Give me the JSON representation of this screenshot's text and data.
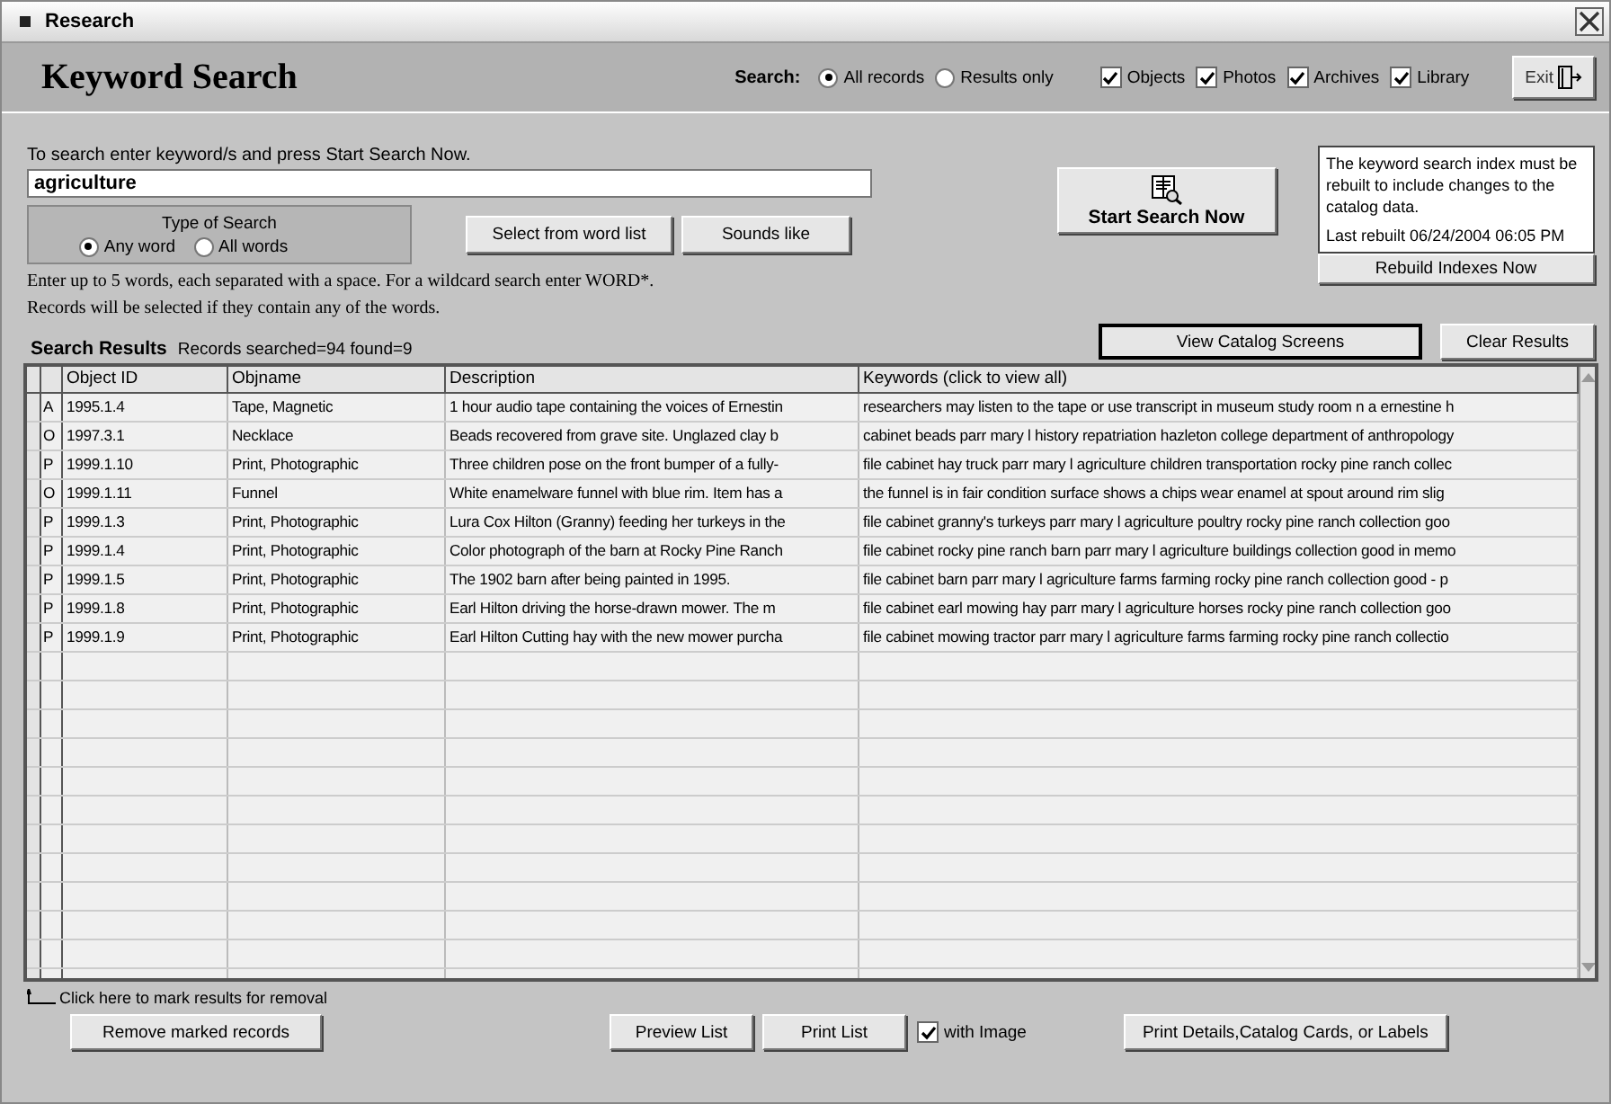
{
  "window": {
    "title": "Research"
  },
  "header": {
    "title": "Keyword Search",
    "search_label": "Search:",
    "scope": [
      {
        "label": "All records",
        "selected": true
      },
      {
        "label": "Results only",
        "selected": false
      }
    ],
    "sources": [
      {
        "label": "Objects",
        "checked": true
      },
      {
        "label": "Photos",
        "checked": true
      },
      {
        "label": "Archives",
        "checked": true
      },
      {
        "label": "Library",
        "checked": true
      }
    ],
    "exit_button": "Exit"
  },
  "search": {
    "instruction": "To search enter keyword/s and press Start Search Now.",
    "value": "agriculture",
    "type_title": "Type of Search",
    "types": [
      {
        "label": "Any word",
        "selected": true
      },
      {
        "label": "All words",
        "selected": false
      }
    ],
    "buttons": [
      "Select from word list",
      "Sounds like"
    ],
    "notes": [
      "Enter up to 5 words, each separated with a space. For a wildcard search enter WORD*.",
      "Records will be selected if they contain any of the words."
    ]
  },
  "start_button": "Start Search Now",
  "index_info": {
    "text": "The keyword search index must be rebuilt to include changes to the catalog data.",
    "last_rebuilt": "Last rebuilt 06/24/2004 06:05 PM",
    "button": "Rebuild Indexes Now"
  },
  "results": {
    "title": "Search Results",
    "summary": "Records searched=94 found=9",
    "buttons": [
      {
        "label": "View Catalog Screens",
        "focused": true
      },
      {
        "label": "Clear Results",
        "focused": false
      }
    ]
  },
  "table": {
    "columns": [
      "Object ID",
      "Objname",
      "Description",
      "Keywords (click to view all)"
    ],
    "rows": [
      {
        "type": "A",
        "object_id": "1995.1.4",
        "objname": "Tape, Magnetic",
        "description": "1 hour audio tape containing the voices of Ernestin",
        "keywords": "researchers may listen to the tape or use transcript in museum study room n a ernestine h"
      },
      {
        "type": "O",
        "object_id": "1997.3.1",
        "objname": "Necklace",
        "description": "Beads recovered from grave site.  Unglazed clay b",
        "keywords": "cabinet beads parr mary l history repatriation hazleton college department of anthropology"
      },
      {
        "type": "P",
        "object_id": "1999.1.10",
        "objname": "Print, Photographic",
        "description": "Three children pose on the front bumper of a fully-",
        "keywords": "file cabinet hay truck parr mary l agriculture children transportation rocky pine ranch collec"
      },
      {
        "type": "O",
        "object_id": "1999.1.11",
        "objname": "Funnel",
        "description": "White enamelware funnel with blue rim.  Item has a",
        "keywords": "the funnel is in fair condition surface shows a chips wear enamel at spout around rim slig"
      },
      {
        "type": "P",
        "object_id": "1999.1.3",
        "objname": "Print, Photographic",
        "description": "Lura Cox Hilton (Granny) feeding her turkeys in the",
        "keywords": "file cabinet granny's turkeys parr mary l agriculture poultry rocky pine ranch collection goo"
      },
      {
        "type": "P",
        "object_id": "1999.1.4",
        "objname": "Print, Photographic",
        "description": "Color photograph of the barn at Rocky Pine Ranch",
        "keywords": "file cabinet rocky pine ranch barn parr mary l agriculture buildings collection good in memo"
      },
      {
        "type": "P",
        "object_id": "1999.1.5",
        "objname": "Print, Photographic",
        "description": "The 1902 barn after being painted in 1995.",
        "keywords": "file cabinet barn parr mary l agriculture farms farming rocky pine ranch collection good - p"
      },
      {
        "type": "P",
        "object_id": "1999.1.8",
        "objname": "Print, Photographic",
        "description": "Earl Hilton driving the horse-drawn mower.  The m",
        "keywords": "file cabinet earl mowing hay parr mary l agriculture horses rocky pine ranch collection goo"
      },
      {
        "type": "P",
        "object_id": "1999.1.9",
        "objname": "Print, Photographic",
        "description": "Earl Hilton Cutting hay with the new mower purcha",
        "keywords": "file cabinet mowing tractor parr mary l agriculture farms farming rocky pine ranch collectio"
      }
    ]
  },
  "footer": {
    "hint": "Click here to mark results for removal",
    "remove_button": "Remove marked records",
    "preview_button": "Preview List",
    "print_button": "Print List",
    "with_image": {
      "label": "with Image",
      "checked": true
    },
    "details_button": "Print Details,Catalog Cards, or Labels"
  }
}
